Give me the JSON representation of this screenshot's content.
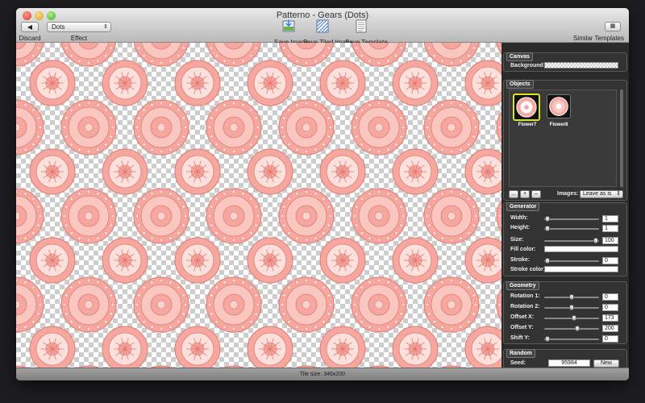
{
  "window": {
    "title": "Patterno - Gears (Dots)"
  },
  "toolbar": {
    "discard_label": "Discard",
    "effect_value": "Dots",
    "effect_label": "Effect",
    "save_image_label": "Save Image",
    "save_tiled_label": "Save Tiled Image",
    "save_template_label": "Save Template",
    "similar_label": "Similar Templates"
  },
  "canvas": {
    "checker_color": "#cdcdcd",
    "motif_fill": "#f6a8a0",
    "motif_stroke": "#e07a72"
  },
  "inspector": {
    "canvas": {
      "title": "Canvas",
      "background_label": "Background:"
    },
    "objects": {
      "title": "Objects",
      "items": [
        {
          "name": "Flower7",
          "selected": true
        },
        {
          "name": "Flower8",
          "selected": false
        }
      ],
      "more_label": "...",
      "add_label": "+",
      "remove_label": "–",
      "images_label": "Images:",
      "images_value": "Leave as is"
    },
    "generator": {
      "title": "Generator",
      "width_label": "Width:",
      "width_value": "1",
      "width_level": 0.02,
      "height_label": "Height:",
      "height_value": "1",
      "height_level": 0.02,
      "size_label": "Size:",
      "size_value": "100",
      "size_level": 0.98,
      "fill_label": "Fill color:",
      "stroke_label": "Stroke:",
      "stroke_value": "0",
      "stroke_level": 0.02,
      "stroke_color_label": "Stroke color:"
    },
    "geometry": {
      "title": "Geometry",
      "rot1_label": "Rotation 1:",
      "rot1_value": "0",
      "rot1_level": 0.5,
      "rot2_label": "Rotation 2:",
      "rot2_value": "0",
      "rot2_level": 0.5,
      "offx_label": "Offset X:",
      "offx_value": "173",
      "offx_level": 0.55,
      "offy_label": "Offset Y:",
      "offy_value": "200",
      "offy_level": 0.62,
      "shifty_label": "Shift Y:",
      "shifty_value": "0",
      "shifty_level": 0.02
    },
    "random": {
      "title": "Random",
      "seed_label": "Seed:",
      "seed_value": "95984",
      "new_label": "New"
    }
  },
  "status": {
    "tile_size": "Tile size: 346x200"
  }
}
